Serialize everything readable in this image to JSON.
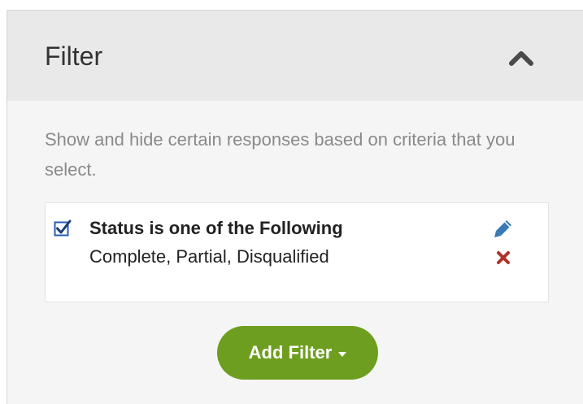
{
  "panel": {
    "title": "Filter",
    "collapse_icon": "chevron-up-icon"
  },
  "description": "Show and hide certain responses based on criteria that you select.",
  "filter": {
    "checked": true,
    "title": "Status is one of the Following",
    "values": "Complete, Partial, Disqualified",
    "edit_icon": "pencil-icon",
    "delete_icon": "close-icon"
  },
  "add_filter_button": {
    "label": "Add Filter",
    "icon": "caret-down-icon"
  },
  "colors": {
    "accent_green": "#6d9e1f",
    "edit_blue": "#3a79b5",
    "delete_red": "#b0322a",
    "checkbox_blue": "#2a5db0"
  }
}
